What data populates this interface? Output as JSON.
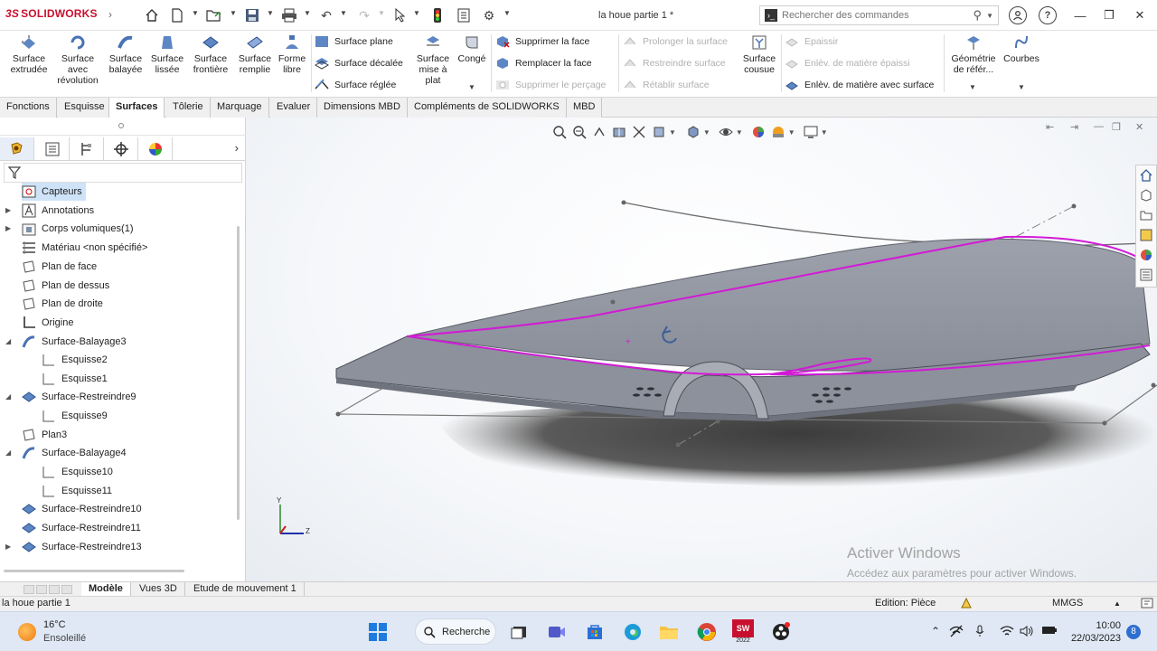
{
  "app": {
    "logo_text": "SOLIDWORKS",
    "doc_title": "la houe partie 1 *"
  },
  "search": {
    "placeholder": "Rechercher des commandes"
  },
  "ribbon": {
    "big_buttons": [
      {
        "label": "Surface extrudée",
        "icon": "surface-extrude-icon"
      },
      {
        "label": "Surface avec révolution",
        "icon": "surface-revolve-icon"
      },
      {
        "label": "Surface balayée",
        "icon": "surface-sweep-icon"
      },
      {
        "label": "Surface lissée",
        "icon": "surface-loft-icon"
      },
      {
        "label": "Surface frontière",
        "icon": "boundary-surface-icon"
      },
      {
        "label": "Surface remplie",
        "icon": "filled-surface-icon"
      },
      {
        "label": "Forme libre",
        "icon": "freeform-icon"
      },
      {
        "label": "Surface mise à plat",
        "icon": "flatten-surface-icon"
      },
      {
        "label": "Congé",
        "icon": "fillet-icon"
      },
      {
        "label": "Surface cousue",
        "icon": "knit-surface-icon"
      },
      {
        "label": "Géométrie de référ...",
        "icon": "reference-geometry-icon"
      },
      {
        "label": "Courbes",
        "icon": "curves-icon"
      }
    ],
    "small_buttons": [
      {
        "label": "Surface plane",
        "disabled": false
      },
      {
        "label": "Surface décalée",
        "disabled": false
      },
      {
        "label": "Surface réglée",
        "disabled": false
      },
      {
        "label": "Supprimer la face",
        "disabled": false
      },
      {
        "label": "Remplacer la face",
        "disabled": false
      },
      {
        "label": "Supprimer le perçage",
        "disabled": true
      },
      {
        "label": "Prolonger la surface",
        "disabled": true
      },
      {
        "label": "Restreindre surface",
        "disabled": true
      },
      {
        "label": "Rétablir surface",
        "disabled": true
      },
      {
        "label": "Epaissir",
        "disabled": true
      },
      {
        "label": "Enlèv. de matière épaissi",
        "disabled": true
      },
      {
        "label": "Enlèv. de matière avec surface",
        "disabled": false
      }
    ]
  },
  "tabs": [
    "Fonctions",
    "Esquisse",
    "Surfaces",
    "Tôlerie",
    "Marquage",
    "Evaluer",
    "Dimensions MBD",
    "Compléments de SOLIDWORKS",
    "MBD"
  ],
  "active_tab": "Surfaces",
  "tree": [
    {
      "label": "Capteurs",
      "expander": false,
      "selected": true
    },
    {
      "label": "Annotations",
      "expander": true
    },
    {
      "label": "Corps volumiques(1)",
      "expander": true
    },
    {
      "label": "Matériau <non spécifié>",
      "expander": false
    },
    {
      "label": "Plan de face",
      "expander": false
    },
    {
      "label": "Plan de dessus",
      "expander": false
    },
    {
      "label": "Plan de droite",
      "expander": false
    },
    {
      "label": "Origine",
      "expander": false
    },
    {
      "label": "Surface-Balayage3",
      "expander": true,
      "expanded": true
    },
    {
      "label": "Esquisse2",
      "child": true
    },
    {
      "label": "Esquisse1",
      "child": true
    },
    {
      "label": "Surface-Restreindre9",
      "expander": true,
      "expanded": true
    },
    {
      "label": "Esquisse9",
      "child": true
    },
    {
      "label": "Plan3",
      "expander": false
    },
    {
      "label": "Surface-Balayage4",
      "expander": true,
      "expanded": true
    },
    {
      "label": "Esquisse10",
      "child": true
    },
    {
      "label": "Esquisse11",
      "child": true
    },
    {
      "label": "Surface-Restreindre10",
      "expander": false
    },
    {
      "label": "Surface-Restreindre11",
      "expander": false
    },
    {
      "label": "Surface-Restreindre13",
      "expander": true
    }
  ],
  "triad": {
    "y_label": "Y",
    "z_label": "Z"
  },
  "watermark": {
    "title": "Activer Windows",
    "subtitle": "Accédez aux paramètres pour activer Windows."
  },
  "bottom_tabs": [
    "Modèle",
    "Vues 3D",
    "Etude de mouvement 1"
  ],
  "active_bottom_tab": "Modèle",
  "status": {
    "left": "la houe partie 1",
    "edition": "Edition: Pièce",
    "units": "MMGS"
  },
  "taskbar": {
    "weather_temp": "16°C",
    "weather_desc": "Ensoleillé",
    "search_label": "Recherche",
    "time": "10:00",
    "date": "22/03/2023",
    "notifications": "8",
    "sw_badge": "2022"
  },
  "colors": {
    "accent": "#2d6fd0",
    "logo": "#c8102e",
    "edge_highlight": "#d21ad6",
    "model_gray": "#8d919c"
  }
}
